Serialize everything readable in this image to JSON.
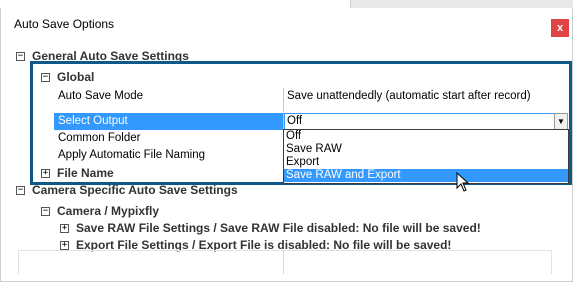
{
  "window": {
    "title": "Auto Save Options",
    "close_label": "x",
    "close_color": "#e04343"
  },
  "tree": {
    "general": {
      "label": "General Auto Save Settings",
      "toggle": "⊟"
    },
    "global": {
      "label": "Global",
      "toggle": "⊟"
    },
    "properties": [
      {
        "name": "Auto Save Mode",
        "value": "Save unattendedly (automatic start after record)"
      },
      {
        "name": "Select Output",
        "value": "Off"
      },
      {
        "name": "Common Folder",
        "value": ""
      },
      {
        "name": "Apply Automatic File Naming",
        "value": ""
      }
    ],
    "file_name": {
      "label": "File Name",
      "toggle": "⊞"
    },
    "camera_specific": {
      "label": "Camera Specific Auto Save Settings",
      "toggle": "⊟"
    },
    "camera": {
      "label": "Camera / Mypixfly",
      "toggle": "⊟"
    },
    "raw_settings": {
      "label": "Save RAW File Settings / Save RAW File disabled: No file will be saved!",
      "toggle": "⊞"
    },
    "export_settings": {
      "label": "Export File Settings / Export File is disabled: No file will be saved!",
      "toggle": "⊞"
    }
  },
  "dropdown": {
    "selected": "Save RAW and Export",
    "options": [
      "Off",
      "Save RAW",
      "Export",
      "Save RAW and Export"
    ],
    "arrow": "▼"
  },
  "colors": {
    "highlight_border": "#0d5a86",
    "selection": "#3399ff"
  }
}
